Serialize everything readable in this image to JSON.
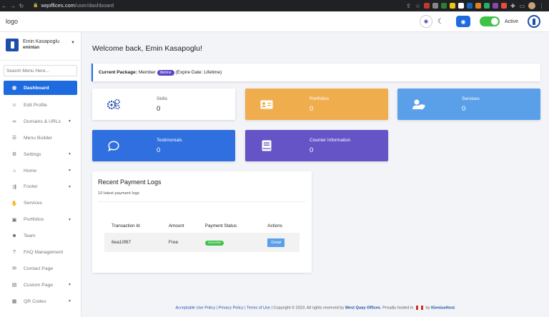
{
  "browser": {
    "url_host": "wqoffices.com",
    "url_path": "/user/dashboard"
  },
  "header": {
    "logo": "logo",
    "status_label": "Active"
  },
  "sidebar": {
    "user_name": "Emin Kasapoglu",
    "user_role": "emintan",
    "search_placeholder": "Search Menu Here...",
    "items": [
      {
        "label": "Dashboard",
        "icon": "palette-icon",
        "active": true
      },
      {
        "label": "Edit Profile",
        "icon": "user-circle-icon"
      },
      {
        "label": "Domains & URLs",
        "icon": "link-icon",
        "submenu": true
      },
      {
        "label": "Menu Builder",
        "icon": "bars-icon"
      },
      {
        "label": "Settings",
        "icon": "gear-icon",
        "submenu": true
      },
      {
        "label": "Home",
        "icon": "home-icon",
        "submenu": true
      },
      {
        "label": "Footer",
        "icon": "footer-icon",
        "submenu": true
      },
      {
        "label": "Services",
        "icon": "handshake-icon"
      },
      {
        "label": "Portfolios",
        "icon": "briefcase-icon",
        "submenu": true
      },
      {
        "label": "Team",
        "icon": "users-icon"
      },
      {
        "label": "FAQ Management",
        "icon": "question-icon"
      },
      {
        "label": "Contact Page",
        "icon": "envelope-icon"
      },
      {
        "label": "Custom Page",
        "icon": "file-icon",
        "submenu": true
      },
      {
        "label": "QR Codes",
        "icon": "qrcode-icon",
        "submenu": true
      }
    ]
  },
  "main": {
    "welcome": "Welcome back, Emin Kasapoglu!",
    "package": {
      "label": "Current Package:",
      "name": "Member",
      "badge": "lifetime",
      "expire": "(Expire Date: Lifetime)"
    },
    "cards": [
      {
        "name": "Skills",
        "value": "0",
        "icon": "gears-icon",
        "color": "#ffffff"
      },
      {
        "name": "Portfolios",
        "value": "0",
        "icon": "id-card-icon",
        "color": "#f0ad4e"
      },
      {
        "name": "Services",
        "value": "0",
        "icon": "user-shield-icon",
        "color": "#5aa0e8"
      },
      {
        "name": "Testimonials",
        "value": "0",
        "icon": "comment-icon",
        "color": "#2f6fdf"
      },
      {
        "name": "Counter Information",
        "value": "0",
        "icon": "book-icon",
        "color": "#6454c6"
      }
    ],
    "payments": {
      "title": "Recent Payment Logs",
      "subtitle": "10 latest payment logs",
      "columns": [
        "Transaction Id",
        "Amount",
        "Payment Status",
        "Actions"
      ],
      "rows": [
        {
          "id": "6ea10f87",
          "amount": "Free",
          "status": "Success",
          "action": "Detail"
        }
      ]
    }
  },
  "footer": {
    "link1": "Acceptable Use Policy",
    "link2": "Privacy Policy",
    "link3": "Terms of Use",
    "copyright": "Copyright © 2023. All rights reserved by",
    "company": "West Quay Offices",
    "hosted": ". Proudly hosted in",
    "by": "by",
    "host": "IGeniusHost"
  }
}
